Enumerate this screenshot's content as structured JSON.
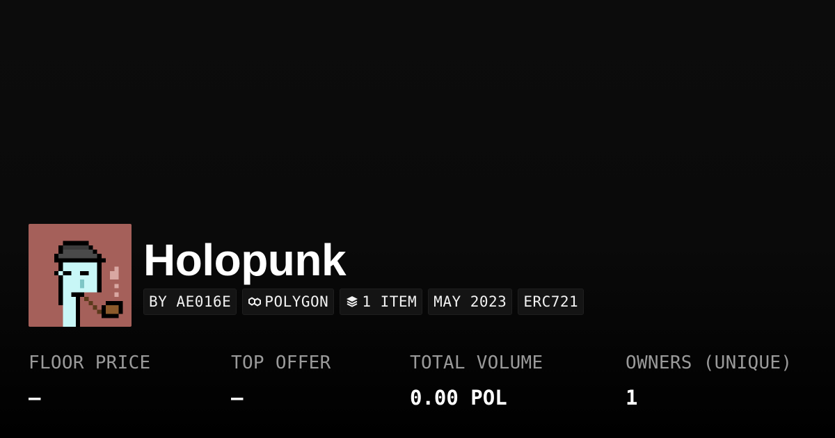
{
  "collection": {
    "title": "Holopunk",
    "avatar_icon": "pixel-punk-avatar",
    "avatar_background": "#a5605a"
  },
  "chips": [
    {
      "label": "BY AE016E",
      "icon": null
    },
    {
      "label": "POLYGON",
      "icon": "polygon-chain-icon"
    },
    {
      "label": "1 ITEM",
      "icon": "layers-icon"
    },
    {
      "label": "MAY 2023",
      "icon": null
    },
    {
      "label": "ERC721",
      "icon": null
    }
  ],
  "stats": [
    {
      "label": "FLOOR PRICE",
      "value": "–"
    },
    {
      "label": "TOP OFFER",
      "value": "–"
    },
    {
      "label": "TOTAL VOLUME",
      "value": "0.00 POL"
    },
    {
      "label": "OWNERS (UNIQUE)",
      "value": "1"
    }
  ],
  "colors": {
    "background": "#0a0a0a",
    "chip_background": "#141414",
    "label_gray": "#9a9a9a",
    "text": "#ffffff"
  }
}
